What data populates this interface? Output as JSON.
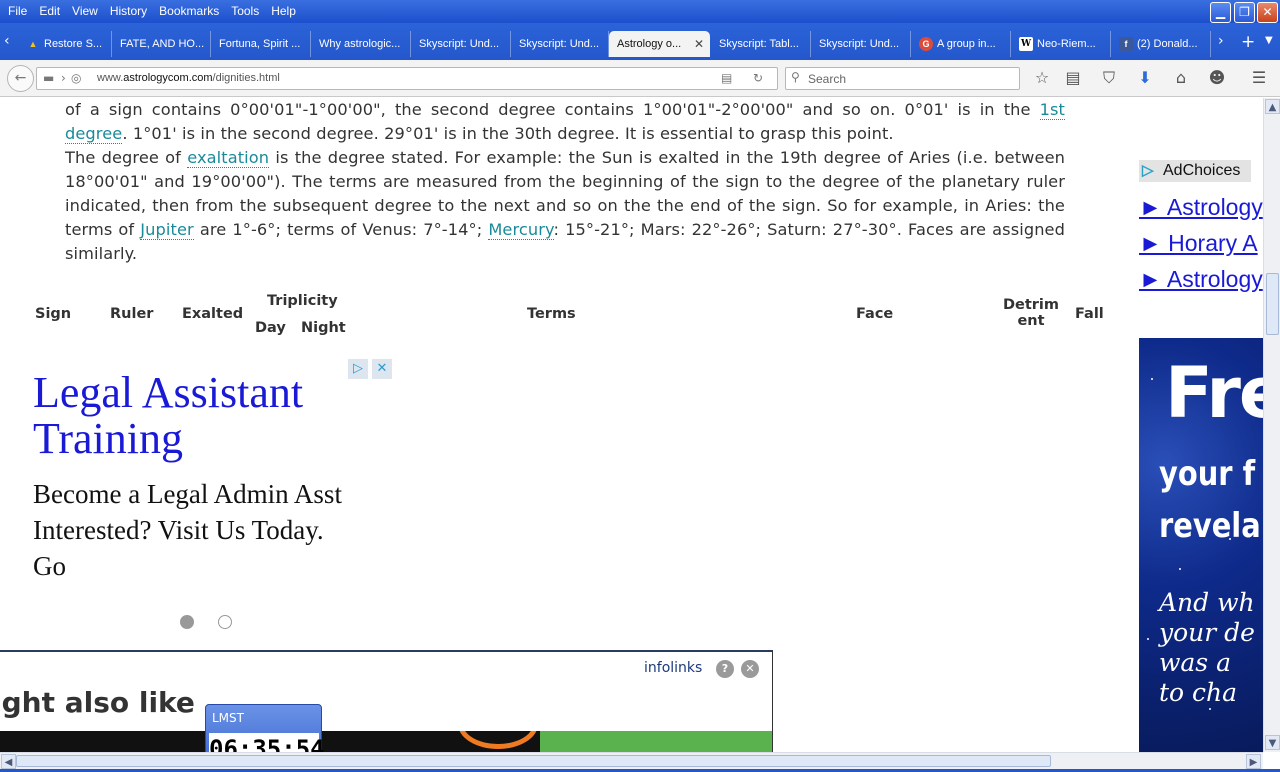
{
  "menu": [
    "File",
    "Edit",
    "View",
    "History",
    "Bookmarks",
    "Tools",
    "Help"
  ],
  "window_buttons": [
    "minimize",
    "restore",
    "close"
  ],
  "tabs": [
    {
      "label": "Restore S...",
      "icon": "warning-icon"
    },
    {
      "label": "FATE, AND HO...",
      "icon": ""
    },
    {
      "label": "Fortuna, Spirit ...",
      "icon": ""
    },
    {
      "label": "Why astrologic...",
      "icon": ""
    },
    {
      "label": "Skyscript: Und...",
      "icon": ""
    },
    {
      "label": "Skyscript: Und...",
      "icon": ""
    },
    {
      "label": "Astrology o...",
      "icon": "",
      "active": true
    },
    {
      "label": "Skyscript: Tabl...",
      "icon": ""
    },
    {
      "label": "Skyscript: Und...",
      "icon": ""
    },
    {
      "label": "A group in...",
      "icon": "google-plus-icon"
    },
    {
      "label": "Neo-Riem...",
      "icon": "wikipedia-icon"
    },
    {
      "label": "(2) Donald...",
      "icon": "facebook-icon"
    }
  ],
  "url": {
    "prefix": "www.",
    "domain": "astrologycom.com",
    "path": "/dignities.html"
  },
  "search": {
    "placeholder": "Search"
  },
  "article": {
    "p1_a": "of a sign contains 0°00'01\"-1°00'00\", the second degree contains 1°00'01\"-2°00'00\" and so on. 0°01' is in the ",
    "p1_link": "1st degree",
    "p1_b": ". 1°01' is in the second degree. 29°01' is in the 30th degree. It is essential to grasp this point.",
    "p2_a": "The degree of ",
    "p2_link1": "exaltation",
    "p2_b": " is the degree stated. For example: the Sun is exalted in the 19th degree of Aries (i.e. between 18°00'01\" and 19°00'00\"). The terms are measured from the beginning of the sign to the degree of the planetary ruler indicated, then from the subsequent degree to the next and so on the the end of the sign. So for example, in Aries: the terms of ",
    "p2_link2": "Jupiter",
    "p2_c": " are 1°-6°; terms of Venus: 7°-14°; ",
    "p2_link3": "Mercury",
    "p2_d": ": 15°-21°; Mars: 22°-26°; Saturn: 27°-30°. Faces are assigned similarly."
  },
  "table_headers": {
    "sign": "Sign",
    "ruler": "Ruler",
    "exalted": "Exalted",
    "triplicity": "Triplicity",
    "day": "Day",
    "night": "Night",
    "terms": "Terms",
    "face": "Face",
    "detriment_1": "Detrim",
    "detriment_2": "ent",
    "fall": "Fall"
  },
  "ad": {
    "title": "Legal Assistant Training",
    "line1": "Become a Legal Admin Asst",
    "line2": "Interested? Visit Us Today.",
    "line3": "Go"
  },
  "sidebar": {
    "adchoices": "AdChoices",
    "links": [
      "► Astrology",
      "► Horary A",
      "► Astrology"
    ],
    "banner_line1": "Fre",
    "banner_line2": "your f",
    "banner_line3": "revela",
    "banner_line4": "And wh",
    "banner_line5": "your de",
    "banner_line6": "was a",
    "banner_line7": "to cha"
  },
  "infolinks": {
    "logo": "infolinks",
    "heading": "ight also like"
  },
  "clock": {
    "label": "LMST",
    "time": "06:35:54"
  },
  "colors": {
    "link": "#1a8a9a",
    "ad_link": "#1a1ad6",
    "titlebar": "#2457cc"
  }
}
